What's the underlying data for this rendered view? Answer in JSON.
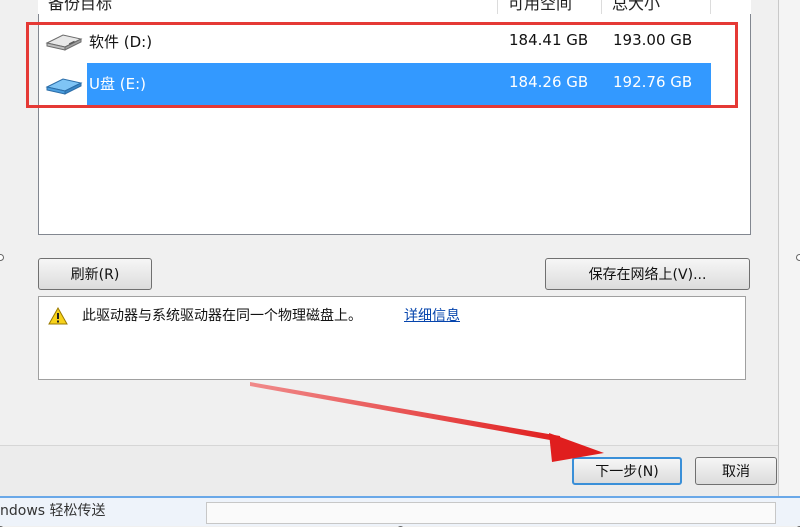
{
  "columns": [
    "备份目标",
    "可用空间",
    "总大小"
  ],
  "drives": [
    {
      "name": "软件 (D:)",
      "free": "184.41 GB",
      "total": "193.00 GB",
      "selected": false,
      "icon": "hard-drive-icon"
    },
    {
      "name": "U盘 (E:)",
      "free": "184.26 GB",
      "total": "192.76 GB",
      "selected": true,
      "icon": "usb-drive-icon"
    }
  ],
  "buttons": {
    "refresh": "刷新(R)",
    "save_network": "保存在网络上(V)...",
    "next": "下一步(N)",
    "cancel": "取消"
  },
  "warning": {
    "icon": "warning-icon",
    "text": "此驱动器与系统驱动器在同一个物理磁盘上。",
    "link": "详细信息"
  },
  "taskbar": {
    "title": "ndows 轻松传送"
  },
  "colors": {
    "selection": "#3399ff",
    "highlight_box": "#e53935",
    "annotation_arrow": "#e53935",
    "link": "#0645ad"
  }
}
